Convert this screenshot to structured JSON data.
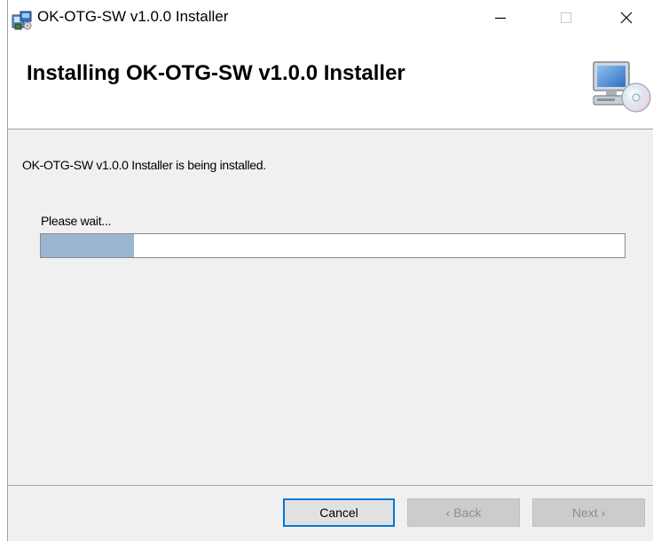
{
  "window": {
    "title": "OK-OTG-SW v1.0.0 Installer",
    "app_icon": "installer-package-icon",
    "controls": {
      "minimize_icon": "minimize-icon",
      "maximize_icon": "maximize-icon",
      "close_icon": "close-icon"
    }
  },
  "header": {
    "title": "Installing OK-OTG-SW v1.0.0 Installer",
    "icon": "computer-cd-icon"
  },
  "body": {
    "status_text": "OK-OTG-SW v1.0.0 Installer is being installed.",
    "wait_text": "Please wait...",
    "progress": {
      "fraction": 0.16,
      "fill_color": "#9bb5d2"
    }
  },
  "footer": {
    "cancel_label": "Cancel",
    "back_label": "‹ Back",
    "next_label": "Next ›",
    "back_enabled": false,
    "next_enabled": false,
    "focus_color": "#0078d7"
  }
}
